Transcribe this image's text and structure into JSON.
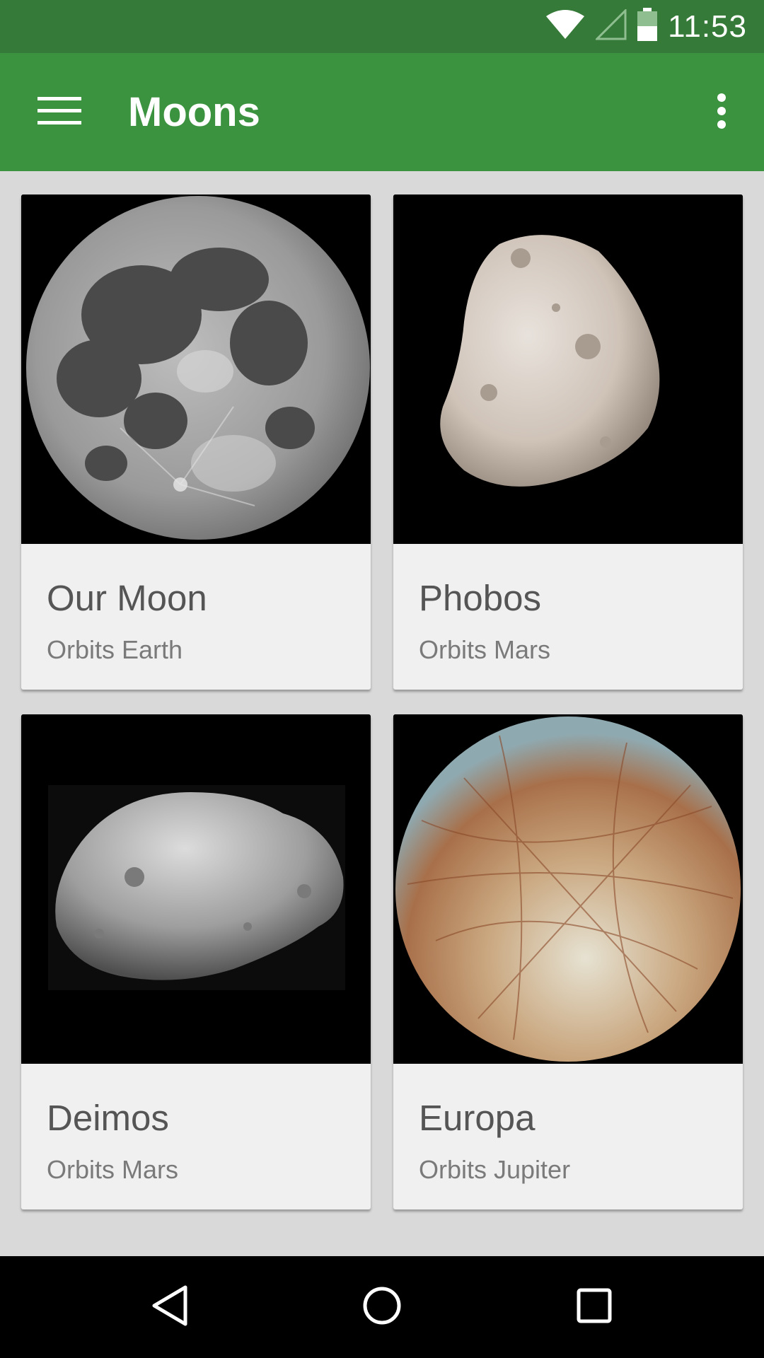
{
  "status_bar": {
    "time": "11:53",
    "icons": [
      "wifi-icon",
      "cell-signal-icon",
      "battery-icon"
    ]
  },
  "app_bar": {
    "title": "Moons",
    "menu_icon": "hamburger-menu-icon",
    "overflow_icon": "more-vertical-icon",
    "color": "#3b923f",
    "status_color": "#357a38"
  },
  "cards": [
    {
      "title": "Our Moon",
      "subtitle": "Orbits Earth",
      "image": "moon-photo"
    },
    {
      "title": "Phobos",
      "subtitle": "Orbits Mars",
      "image": "phobos-photo"
    },
    {
      "title": "Deimos",
      "subtitle": "Orbits Mars",
      "image": "deimos-photo"
    },
    {
      "title": "Europa",
      "subtitle": "Orbits Jupiter",
      "image": "europa-photo"
    }
  ],
  "nav_bar": {
    "buttons": [
      "back-icon",
      "home-icon",
      "recents-icon"
    ]
  }
}
